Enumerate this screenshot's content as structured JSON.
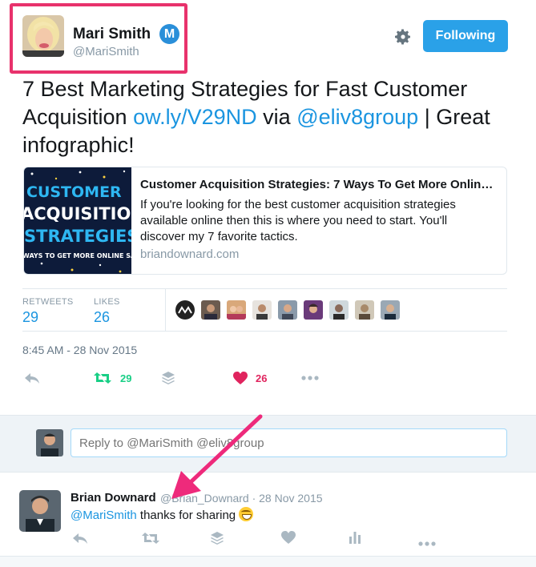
{
  "author": {
    "name": "Mari Smith",
    "handle": "@MariSmith",
    "verified_badge": "M"
  },
  "header": {
    "following_label": "Following",
    "settings_icon": "gear-icon"
  },
  "tweet": {
    "text_start": "7 Best Marketing Strategies for Fast Customer Acquisition ",
    "link": "ow.ly/V29ND",
    "via": " via ",
    "mention": "@eliv8group",
    "text_end": " | Great infographic!"
  },
  "card": {
    "image_lines": [
      "CUSTOMER",
      "ACQUISITION",
      "STRATEGIES",
      "WAYS TO GET MORE ONLINE SALE"
    ],
    "title": "Customer Acquisition Strategies: 7 Ways To Get More Onlin…",
    "description": "If you're looking for the best customer acquisition strategies available online then this is where you need to start. You'll discover my 7 favorite tactics.",
    "domain": "briandownard.com"
  },
  "stats": {
    "retweets_label": "RETWEETS",
    "retweets_value": "29",
    "likes_label": "LIKES",
    "likes_value": "26"
  },
  "timestamp": "8:45 AM - 28 Nov 2015",
  "actions": {
    "retweet_count": "29",
    "like_count": "26"
  },
  "reply_box": {
    "placeholder": "Reply to @MariSmith @eliv8group"
  },
  "reply": {
    "name": "Brian Downard",
    "handle_date": "@Brian_Downard · 28 Nov 2015",
    "mention": "@MariSmith",
    "text": " thanks for sharing"
  },
  "colors": {
    "accent": "#1b95e0",
    "following": "#2aa1e8",
    "highlight": "#e8326c",
    "retweet": "#19cf86",
    "like": "#e0245e"
  }
}
